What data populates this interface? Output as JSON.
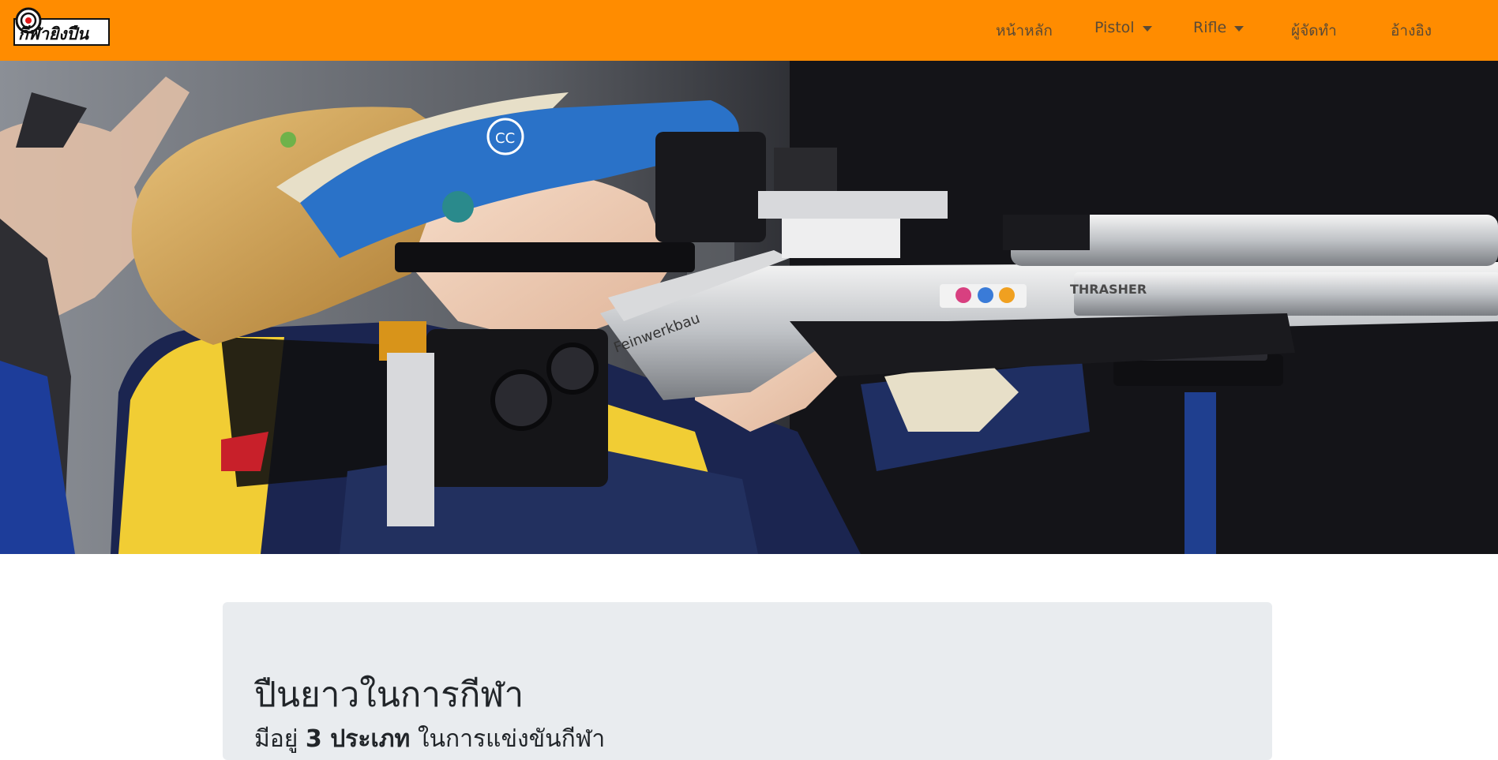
{
  "navbar": {
    "brand_text": "กีฬายิงปืน",
    "background": "#ff8c00",
    "items": [
      {
        "label": "หน้าหลัก",
        "dropdown": false
      },
      {
        "label": "Pistol",
        "dropdown": true
      },
      {
        "label": "Rifle",
        "dropdown": true
      },
      {
        "label": "ผู้จัดทำ",
        "dropdown": false
      },
      {
        "label": "อ้างอิง",
        "dropdown": false
      }
    ]
  },
  "hero": {
    "rifle_text": "THRASHER",
    "brand_text": "Feinwerkbau",
    "visor_logo": "CC"
  },
  "content": {
    "title": "ปืนยาวในการกีฬา",
    "subtitle_start": "มีอยู่",
    "subtitle_bold": "3 ประเภท",
    "subtitle_end": "ในการแข่งขันกีฬา"
  }
}
